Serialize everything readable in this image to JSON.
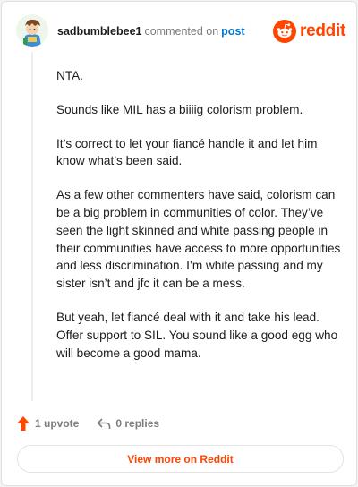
{
  "comment": {
    "author": "sadbumblebee1",
    "action_text": "commented on",
    "post_link": "post",
    "paragraphs": [
      "NTA.",
      "Sounds like MIL has a biiiig colorism problem.",
      "It’s correct to let your fiancé handle it and let him know what’s been said.",
      "As a few other commenters have said, colorism can be a big problem in communities of color. They’ve seen the light skinned and white passing people in their communities have access to more opportunities and less discrimination. I’m white passing and my sister isn’t and jfc it can be a mess.",
      "But yeah, let fiancé deal with it and take his lead. Offer support to SIL. You sound like a good egg who will become a good mama."
    ]
  },
  "brand": {
    "name": "reddit",
    "color": "#ff4500",
    "icon": "reddit-logo-icon"
  },
  "actions": {
    "upvote_label": "1 upvote",
    "upvote_icon": "upvote-arrow-icon",
    "replies_label": "0 replies",
    "replies_icon": "reply-icon"
  },
  "footer": {
    "view_more_label": "View more on Reddit"
  },
  "colors": {
    "accent": "#ff4500",
    "link": "#0079d3",
    "text": "#1c1c1c",
    "muted": "#7c7c7c"
  }
}
